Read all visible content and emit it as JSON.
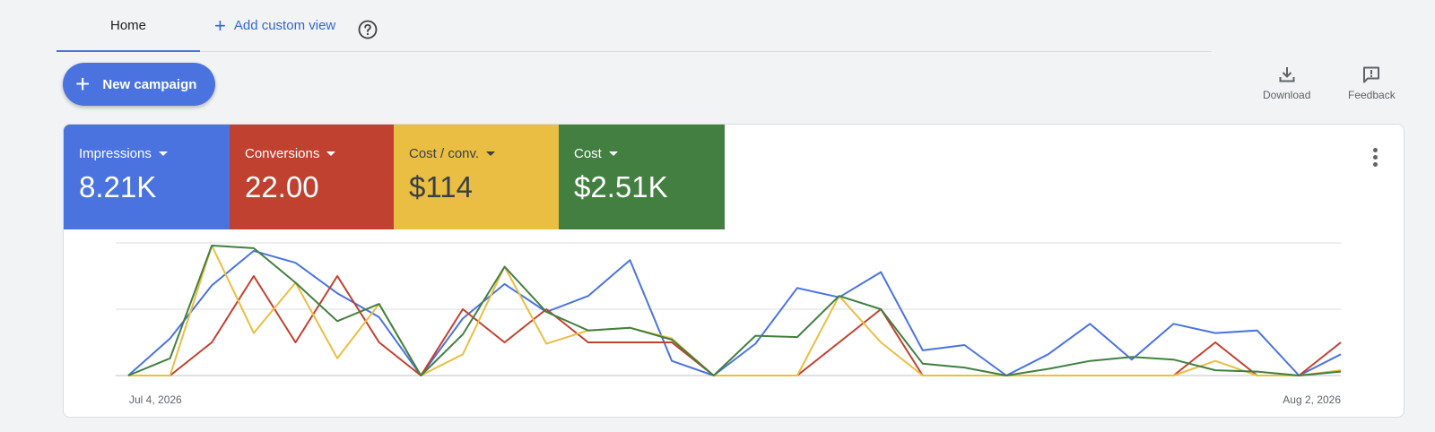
{
  "tabs": {
    "home": "Home",
    "add_custom_view": "Add custom view"
  },
  "toolbar": {
    "new_campaign": "New campaign",
    "download": "Download",
    "feedback": "Feedback"
  },
  "metrics": [
    {
      "label": "Impressions",
      "value": "8.21K",
      "color": "#4a73df"
    },
    {
      "label": "Conversions",
      "value": "22.00",
      "color": "#c0412f"
    },
    {
      "label": "Cost / conv.",
      "value": "$114",
      "color": "#e9be43"
    },
    {
      "label": "Cost",
      "value": "$2.51K",
      "color": "#427f40"
    }
  ],
  "chart_data": {
    "type": "line",
    "x_start_label": "Jul 4, 2026",
    "x_end_label": "Aug 2, 2026",
    "ylim": [
      0,
      1
    ],
    "grid": true,
    "series": [
      {
        "name": "Impressions",
        "color": "#4a73df",
        "values": [
          0,
          0.28,
          0.68,
          0.94,
          0.85,
          0.62,
          0.44,
          0,
          0.43,
          0.69,
          0.48,
          0.6,
          0.87,
          0.11,
          0,
          0.24,
          0.66,
          0.59,
          0.78,
          0.19,
          0.23,
          0,
          0.16,
          0.39,
          0.12,
          0.39,
          0.32,
          0.34,
          0,
          0.16
        ]
      },
      {
        "name": "Conversions",
        "color": "#c0412f",
        "values": [
          0,
          0,
          0.25,
          0.75,
          0.25,
          0.75,
          0.25,
          0,
          0.5,
          0.25,
          0.5,
          0.25,
          0.25,
          0.25,
          0,
          0,
          0,
          0.25,
          0.5,
          0,
          0,
          0,
          0,
          0,
          0,
          0,
          0.25,
          0,
          0,
          0.25
        ]
      },
      {
        "name": "Cost / conv.",
        "color": "#e9be43",
        "values": [
          0,
          0,
          0.98,
          0.32,
          0.7,
          0.13,
          0.54,
          0,
          0.16,
          0.82,
          0.24,
          0.34,
          0.36,
          0.28,
          0,
          0,
          0,
          0.6,
          0.25,
          0,
          0,
          0,
          0,
          0,
          0,
          0,
          0.11,
          0,
          0,
          0.04
        ]
      },
      {
        "name": "Cost",
        "color": "#427f40",
        "values": [
          0,
          0.13,
          0.98,
          0.96,
          0.7,
          0.41,
          0.54,
          0,
          0.31,
          0.82,
          0.48,
          0.34,
          0.36,
          0.27,
          0,
          0.3,
          0.29,
          0.6,
          0.5,
          0.09,
          0.06,
          0,
          0.05,
          0.11,
          0.14,
          0.12,
          0.04,
          0.03,
          0,
          0.03
        ]
      }
    ]
  }
}
